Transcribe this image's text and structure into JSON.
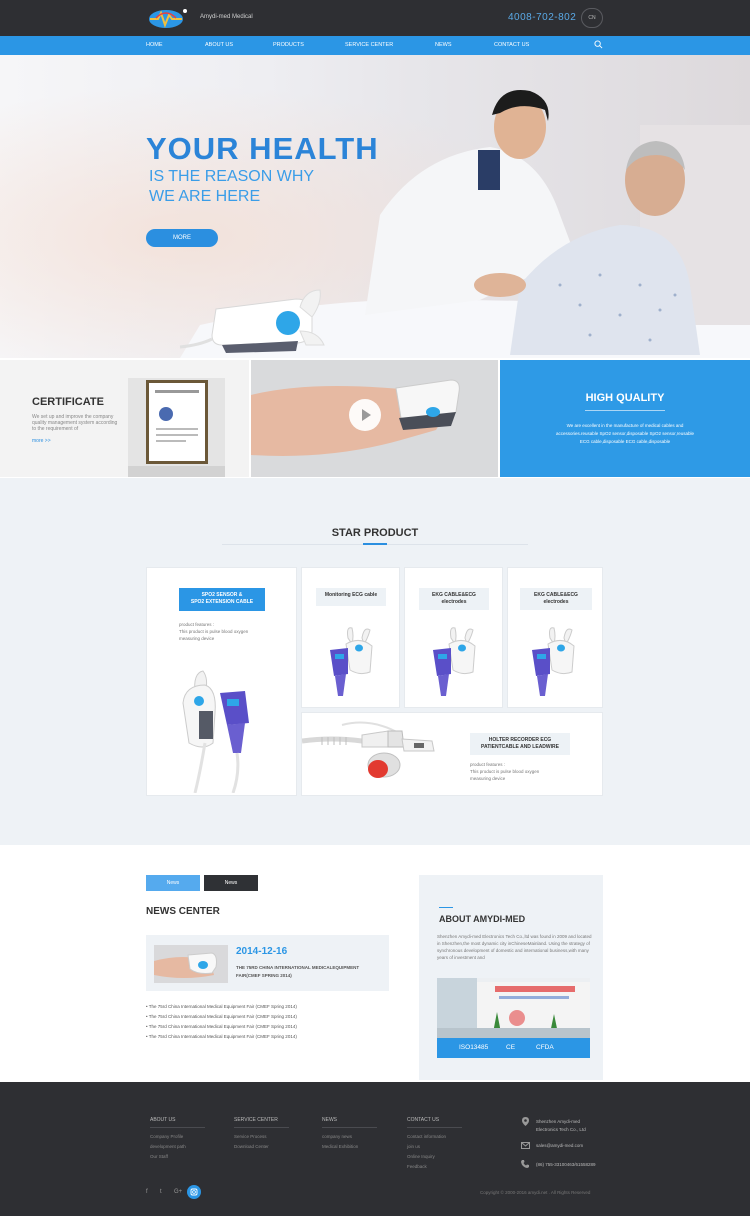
{
  "header": {
    "brand": "Amydi-med Medical",
    "phone": "4008-702-802",
    "lang": "CN"
  },
  "nav": {
    "items": [
      "HOME",
      "ABOUT US",
      "PRODUCTS",
      "SERVICE CENTER",
      "NEWS",
      "CONTACT US"
    ]
  },
  "hero": {
    "headline": "YOUR  HEALTH",
    "line1": "IS THE REASON WHY",
    "line2": "WE ARE HERE",
    "more": "MORE"
  },
  "features": {
    "certificate": {
      "title": "CERTIFICATE",
      "text": "We set up and improve the company quality management system according to the requirement of",
      "more": "more >>"
    },
    "quality": {
      "title": "HIGH QUALITY",
      "text": "We are excellent in the manufacture of medical cables and accessories.reusable SpO2 sensor,disposable SpO2 sensor,reusable ECG cable,disposable ECG cable,disposable"
    }
  },
  "star": {
    "title": "STAR PRODUCT",
    "main": {
      "tag1": "SPO2 SENSOR &",
      "tag2": "SPO2 EXTENSION CABLE",
      "pf_label": "product features :",
      "pf_text": "This product is pulse blood oxygen measuring device"
    },
    "cards": [
      {
        "tag": "Monitoring ECG cable"
      },
      {
        "tag1": "EKG CABLE&ECG",
        "tag2": "electrodes"
      },
      {
        "tag1": "EKG CABLE&ECG",
        "tag2": "electrodes"
      }
    ],
    "holter": {
      "tag1": "HOLTER RECORDER ECG",
      "tag2": "PATIENTCABLE AND LEADWIRE",
      "pf_label": "product features :",
      "pf_text": "This product is pulse blood oxygen measuring device"
    }
  },
  "news": {
    "tab1": "News",
    "tab2": "News",
    "title": "NEWS CENTER",
    "date": "2014-12-16",
    "headline": "THE 75RD CHINA INTERNATIONAL MEDICALEQUIPMENT FAIR(CMEF SPRING 2014)",
    "list": [
      "The 75rd China International Medical Equipment Fair (CMEF Spring 2014)",
      "The 75rd China International Medical Equipment Fair (CMEF Spring 2014)",
      "The 75rd China International Medical Equipment Fair (CMEF Spring 2014)",
      "The 75rd China International Medical Equipment Fair (CMEF Spring 2014)"
    ]
  },
  "about": {
    "title": "ABOUT AMYDI-MED",
    "text": "Shenzhen Amydi-med Electronics Tech Co.,ltd was found in 2009 and located in Shenzhen,the most dynamic city inChineseMainland. Using the strategy of synchronous development of domestic and international business,with many years of investment and",
    "certs": [
      "ISO13485",
      "CE",
      "CFDA"
    ]
  },
  "footer": {
    "cols": [
      {
        "title": "ABOUT US",
        "links": [
          "Company Profile",
          "development path",
          "Our Staff"
        ]
      },
      {
        "title": "SERVICE CENTER",
        "links": [
          "Service Process",
          "Download Center"
        ]
      },
      {
        "title": "NEWS",
        "links": [
          "company news",
          "Medical Exhibition"
        ]
      },
      {
        "title": "CONTACT US",
        "links": [
          "Contact information",
          "join us",
          "Online Inquiry",
          "Feedback"
        ]
      }
    ],
    "company1": "Shenzhen Amydi-med",
    "company2": "Electronics Tech Co., Ltd",
    "email": "sales@amydi-med.com",
    "tel": "(86) 755-33100463/61558289",
    "copyright": "Copyright © 2000-2016 amydi.net . All Rights Reserved",
    "social": [
      "f",
      "t",
      "G+"
    ],
    "colors": {
      "accent": "#2b96e5",
      "dark": "#2e2f33"
    }
  }
}
